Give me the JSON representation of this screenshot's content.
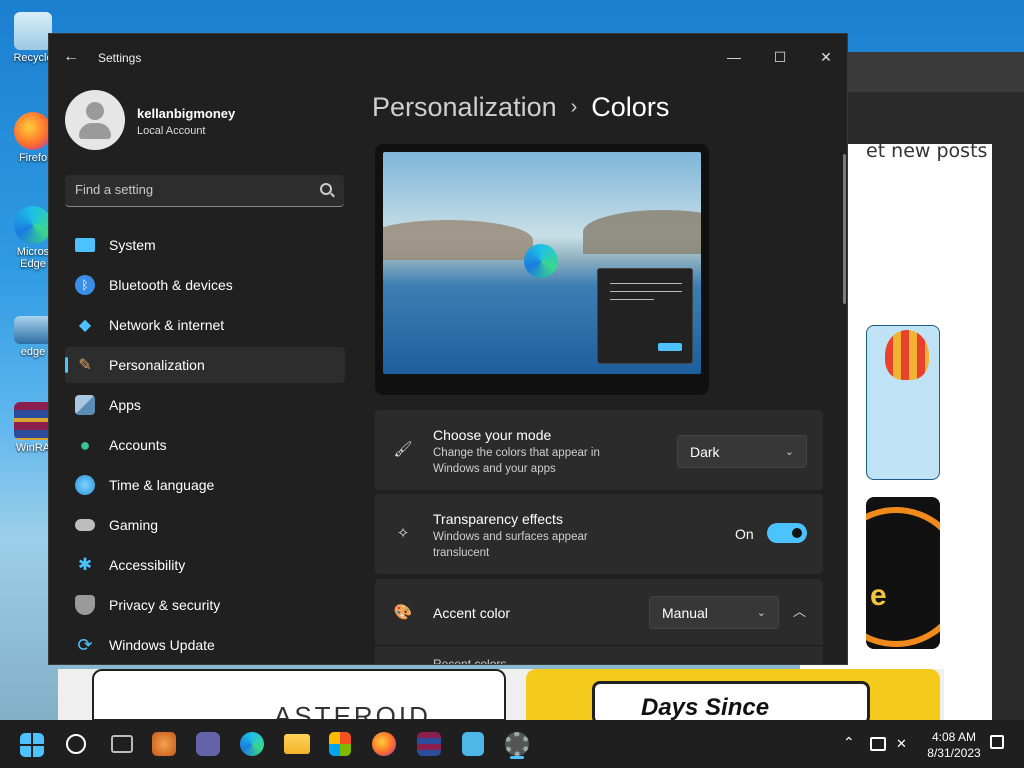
{
  "desktop": {
    "icons": [
      {
        "label": "Recycle",
        "icon": "recycle-bin-icon"
      },
      {
        "label": "Firefo",
        "icon": "firefox-icon"
      },
      {
        "label": "Micros Edge",
        "icon": "edge-icon"
      },
      {
        "label": "edge",
        "icon": "image-file-icon"
      },
      {
        "label": "WinRA",
        "icon": "winrar-icon"
      }
    ]
  },
  "background_browser": {
    "visible_text": "et new posts",
    "bottom_text_1": "ASTEROID",
    "bottom_text_2": "Days Since",
    "side_text": "e"
  },
  "window": {
    "title": "Settings",
    "controls": {
      "minimize": "—",
      "maximize": "☐",
      "close": "✕"
    }
  },
  "account": {
    "name": "kellanbigmoney",
    "type": "Local Account"
  },
  "search": {
    "placeholder": "Find a setting"
  },
  "nav": {
    "items": [
      {
        "label": "System",
        "icon": "system-icon",
        "color": "#4cc2ff"
      },
      {
        "label": "Bluetooth & devices",
        "icon": "bluetooth-icon",
        "color": "#3a8ee6"
      },
      {
        "label": "Network & internet",
        "icon": "wifi-icon",
        "color": "#4cc2ff"
      },
      {
        "label": "Personalization",
        "icon": "brush-icon",
        "color": "#e3a36a",
        "active": true
      },
      {
        "label": "Apps",
        "icon": "apps-icon",
        "color": "#8fb8d8"
      },
      {
        "label": "Accounts",
        "icon": "accounts-icon",
        "color": "#3ac48f"
      },
      {
        "label": "Time & language",
        "icon": "globe-clock-icon",
        "color": "#4cc2ff"
      },
      {
        "label": "Gaming",
        "icon": "controller-icon",
        "color": "#bdbdbd"
      },
      {
        "label": "Accessibility",
        "icon": "accessibility-icon",
        "color": "#4cc2ff"
      },
      {
        "label": "Privacy & security",
        "icon": "shield-icon",
        "color": "#9a9a9a"
      },
      {
        "label": "Windows Update",
        "icon": "update-icon",
        "color": "#4cc2ff"
      }
    ]
  },
  "breadcrumb": {
    "parent": "Personalization",
    "separator": "›",
    "current": "Colors"
  },
  "mode": {
    "title": "Choose your mode",
    "subtitle": "Change the colors that appear in Windows and your apps",
    "value": "Dark"
  },
  "transparency": {
    "title": "Transparency effects",
    "subtitle": "Windows and surfaces appear translucent",
    "state_label": "On",
    "enabled": true
  },
  "accent": {
    "title": "Accent color",
    "value": "Manual",
    "partial_next": "Recent colors"
  },
  "taskbar": {
    "time": "4:08 AM",
    "date": "8/31/2023",
    "tray_up": "⌃",
    "accent": "#4cc2ff"
  }
}
